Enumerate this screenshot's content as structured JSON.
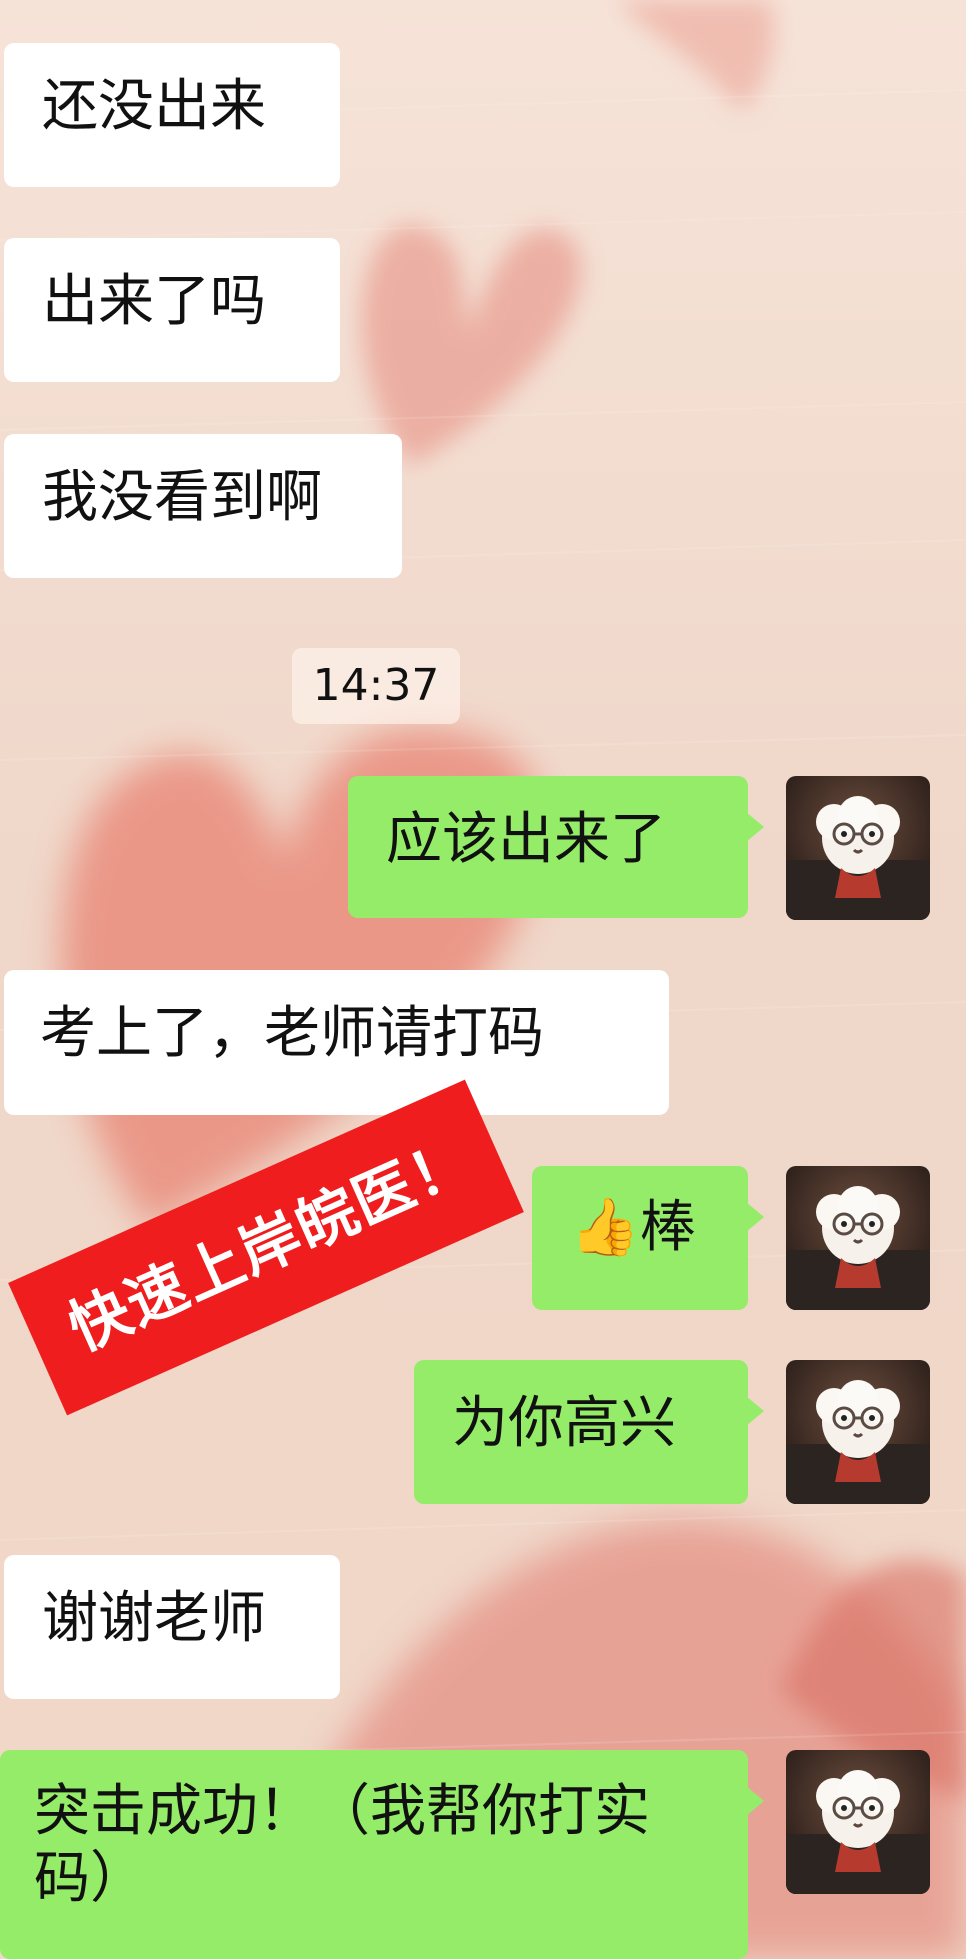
{
  "chat": {
    "messages": [
      {
        "side": "left",
        "text": "还没出来"
      },
      {
        "side": "left",
        "text": "出来了吗"
      },
      {
        "side": "left",
        "text": "我没看到啊"
      },
      {
        "side": "right",
        "text": "应该出来了"
      },
      {
        "side": "left",
        "text": "考上了，老师请打码"
      },
      {
        "side": "right",
        "emoji": "👍",
        "text": "棒"
      },
      {
        "side": "right",
        "text": "为你高兴"
      },
      {
        "side": "left",
        "text": "谢谢老师"
      },
      {
        "side": "right",
        "text": "突击成功！（我帮你打实码）"
      }
    ],
    "timestamp": "14:37"
  },
  "overlay": {
    "stamp_text": "快速上岸皖医！",
    "stamp_color": "#ef1d1d"
  },
  "theme": {
    "left_bubble_color": "#ffffff",
    "right_bubble_color": "#95ec69",
    "background_color": "#f2dccd",
    "heart_color": "#e57f72"
  },
  "avatar": {
    "icon": "fluffy-dog-with-glasses-icon"
  }
}
